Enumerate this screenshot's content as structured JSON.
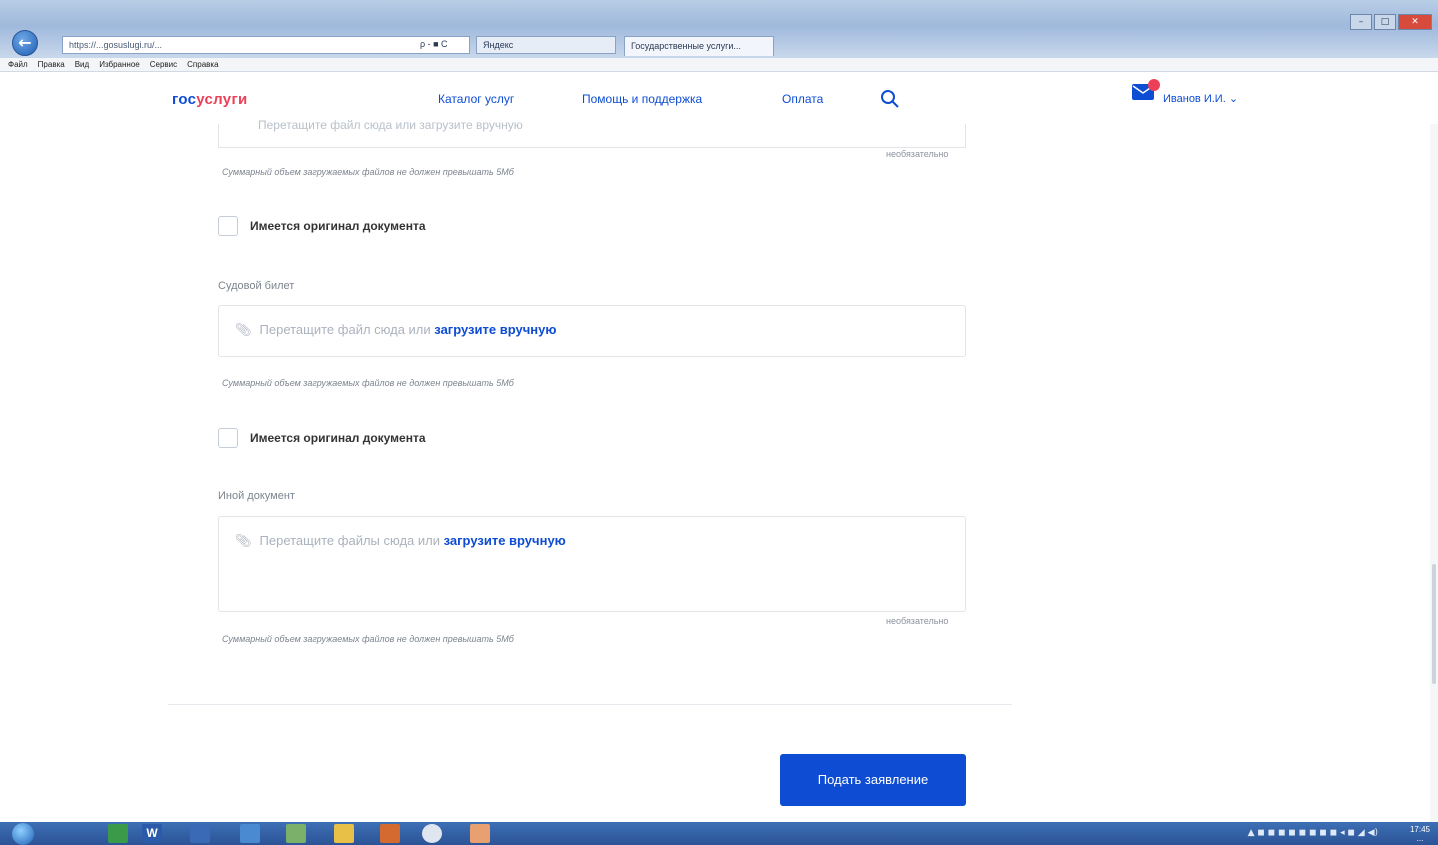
{
  "browser": {
    "address": "https://...gosuslugi.ru/...",
    "address_controls": "ρ - ■ C",
    "search_tab": "Яндекс",
    "tab_title": "Государственные услуги...",
    "menu": [
      "Файл",
      "Правка",
      "Вид",
      "Избранное",
      "Сервис",
      "Справка"
    ]
  },
  "header": {
    "logo_gos": "гос",
    "logo_uslugi": "услуги",
    "nav": [
      "Каталог услуг",
      "Помощь и поддержка",
      "Оплата"
    ],
    "user_name": "Иванов И.И. ⌄"
  },
  "form": {
    "top_upload_text": "Перетащите файл сюда или загрузите вручную",
    "required_1": "необязательно",
    "hint_1": "Суммарный объем загружаемых файлов не должен превышать 5Мб",
    "checkbox_1": "Имеется оригинал документа",
    "field_2_label": "Судовой билет",
    "dz2_text": "Перетащите файл сюда или",
    "dz2_link": "загрузите вручную",
    "hint_2": "Суммарный объем загружаемых файлов не должен превышать 5Мб",
    "checkbox_2": "Имеется оригинал документа",
    "field_3_label": "Иной документ",
    "dz3_text": "Перетащите файлы сюда или",
    "dz3_link": "загрузите вручную",
    "required_3": "необязательно",
    "hint_3": "Суммарный объем загружаемых файлов не должен превышать 5Мб",
    "submit": "Подать заявление"
  },
  "taskbar": {
    "apps": [
      "W"
    ],
    "clock_time": "17:45",
    "clock_date": "..."
  },
  "colors": {
    "brand_blue": "#0d4cd3",
    "brand_red": "#ee3f58"
  }
}
